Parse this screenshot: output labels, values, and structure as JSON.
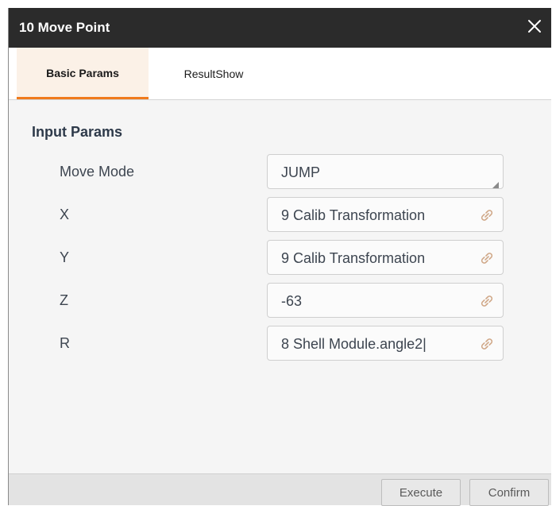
{
  "window": {
    "title": "10 Move Point"
  },
  "tabs": [
    {
      "label": "Basic Params"
    },
    {
      "label": "ResultShow"
    }
  ],
  "input_params": {
    "title": "Input Params",
    "rows": [
      {
        "label": "Move Mode",
        "value": "JUMP"
      },
      {
        "label": "X",
        "value": "9 Calib Transformation"
      },
      {
        "label": "Y",
        "value": "9 Calib Transformation"
      },
      {
        "label": "Z",
        "value": "-63"
      },
      {
        "label": "R",
        "value": "8 Shell Module.angle2|"
      }
    ]
  },
  "footer": {
    "execute_label": "Execute",
    "confirm_label": "Confirm"
  },
  "colors": {
    "accent": "#f07a1c",
    "titlebar": "#2b2b2b",
    "active_tab_bg": "#fbf1e7"
  },
  "icons": {
    "close": "close-icon",
    "link": "link-icon",
    "dropdown": "dropdown-arrow-icon"
  }
}
